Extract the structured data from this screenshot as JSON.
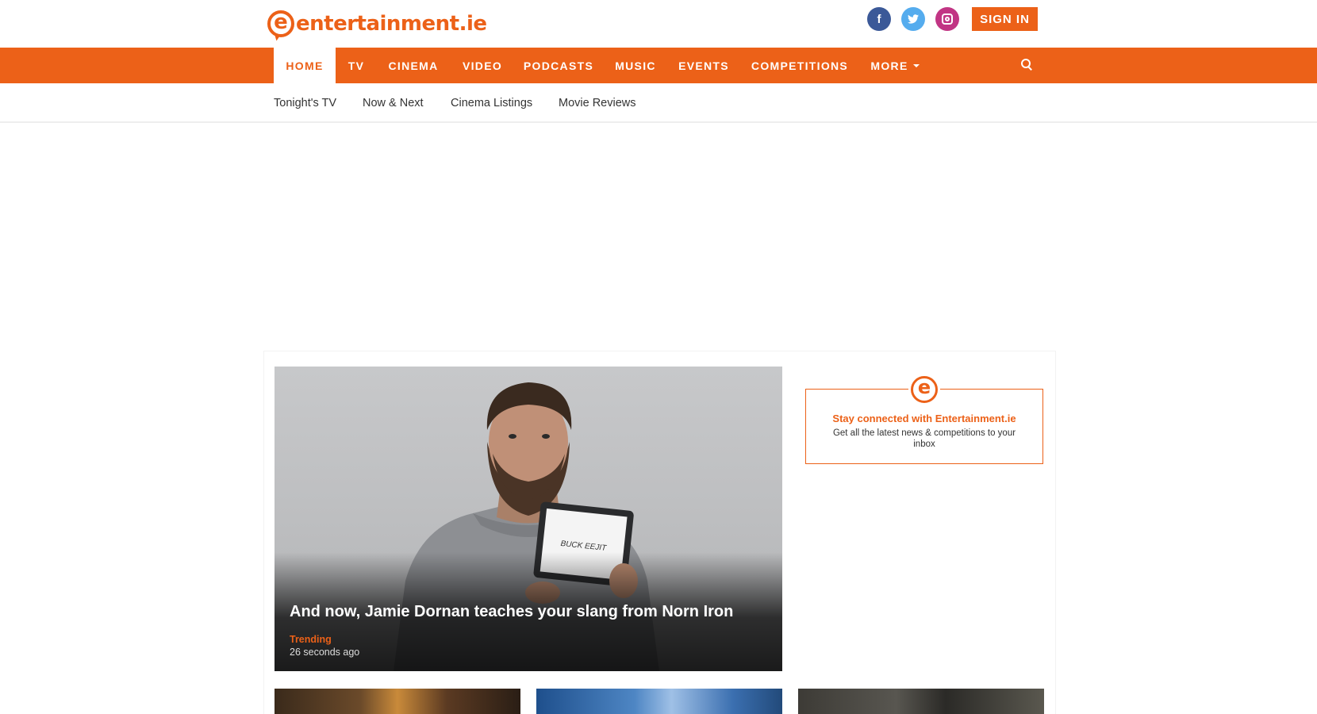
{
  "header": {
    "logo_text": "entertainment.ie",
    "logo_mark": "e",
    "social": [
      {
        "name": "facebook",
        "glyph": "f",
        "color": "#3b5998"
      },
      {
        "name": "twitter",
        "glyph": "t",
        "color": "#55acee"
      },
      {
        "name": "instagram",
        "glyph": "",
        "color": "#c13584"
      }
    ],
    "sign_in_label": "SIGN IN",
    "accent_color": "#ec6118"
  },
  "nav": {
    "items": [
      {
        "label": "HOME",
        "active": true
      },
      {
        "label": "TV"
      },
      {
        "label": "CINEMA"
      },
      {
        "label": "VIDEO"
      },
      {
        "label": "PODCASTS"
      },
      {
        "label": "MUSIC"
      },
      {
        "label": "EVENTS"
      },
      {
        "label": "COMPETITIONS"
      },
      {
        "label": "MORE"
      }
    ],
    "search_icon": "search-icon"
  },
  "subnav": {
    "items": [
      {
        "label": "Tonight's TV"
      },
      {
        "label": "Now & Next"
      },
      {
        "label": "Cinema Listings"
      },
      {
        "label": "Movie Reviews"
      }
    ]
  },
  "hero": {
    "title": "And now, Jamie Dornan teaches your slang from Norn Iron",
    "tag": "Trending",
    "time": "26 seconds ago",
    "tablet_text": "BUCK EEJIT"
  },
  "newsletter": {
    "title": "Stay connected with Entertainment.ie",
    "text": "Get all the latest news & competitions to your inbox"
  }
}
